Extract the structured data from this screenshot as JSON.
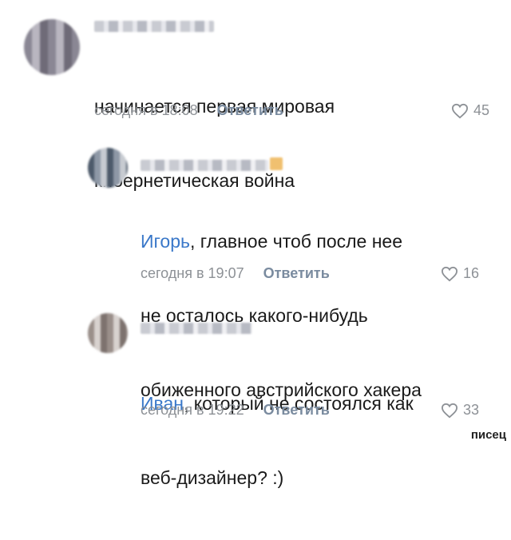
{
  "comments": [
    {
      "text_lines": [
        "начинается первая мировая",
        "кибернетическая война"
      ],
      "mention": "",
      "time": "сегодня в 18:08",
      "reply_label": "Ответить",
      "likes": "45"
    },
    {
      "mention": "Игорь",
      "text_lines": [
        ", главное чтоб после нее",
        "не осталось какого-нибудь",
        "обиженного австрийского хакера"
      ],
      "time": "сегодня в 19:07",
      "reply_label": "Ответить",
      "likes": "16"
    },
    {
      "mention": "Иван",
      "text_lines": [
        ", который не состоялся как",
        "веб-дизайнер? :)"
      ],
      "time": "сегодня в 19:22",
      "reply_label": "Ответить",
      "likes": "33"
    }
  ],
  "watermark": "писец",
  "icons": {
    "like": "heart-icon"
  },
  "colors": {
    "mention": "#3a78c9",
    "meta": "#8d9196"
  }
}
